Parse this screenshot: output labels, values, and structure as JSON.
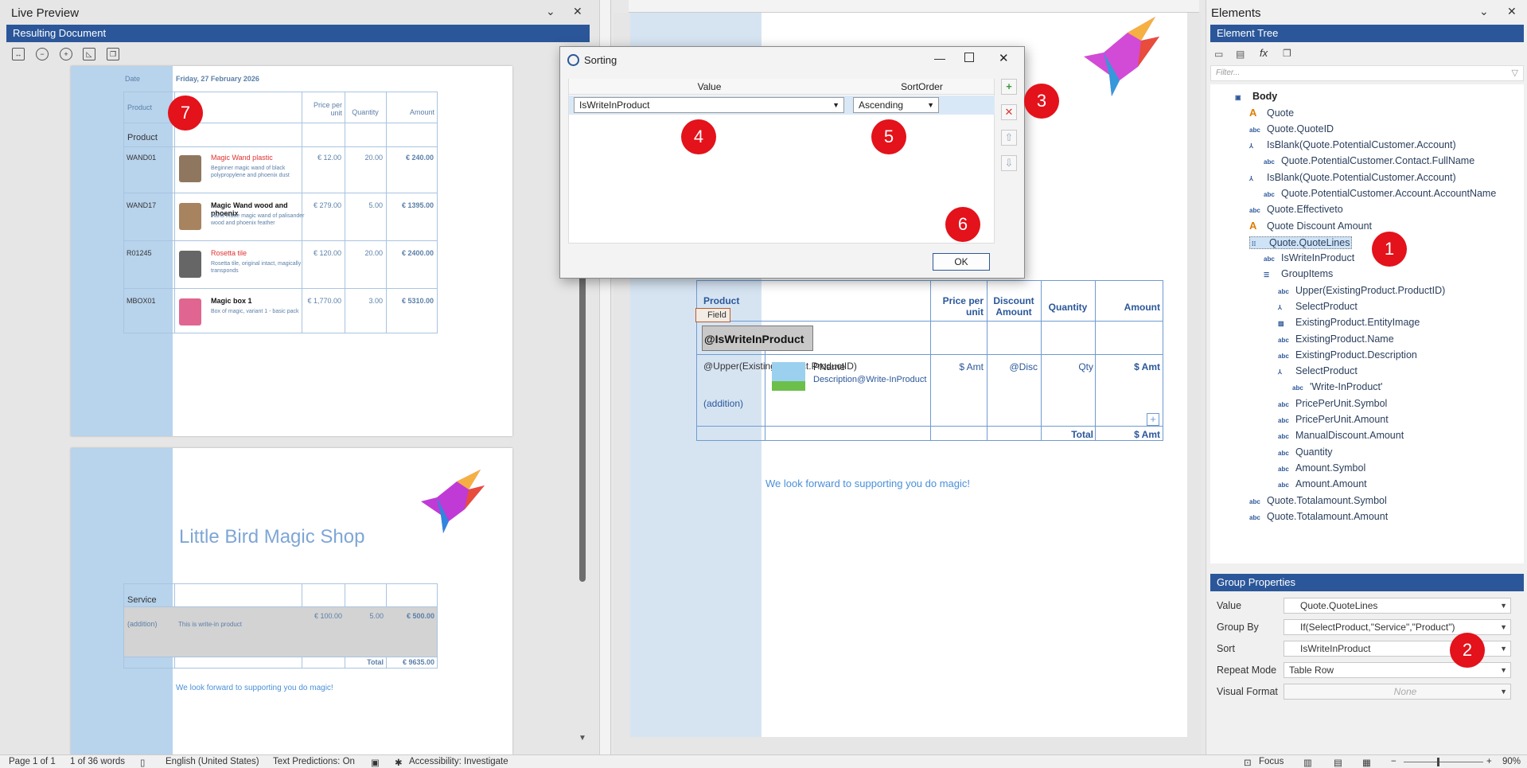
{
  "live_preview": {
    "title": "Live Preview",
    "subtitle": "Resulting Document",
    "page1": {
      "date_label": "Date",
      "date_value": "Friday, 27 February 2026",
      "headers": [
        "Product",
        "Price per unit",
        "Quantity",
        "Amount"
      ],
      "group_label": "Product",
      "rows": [
        {
          "code": "WAND01",
          "name": "Magic Wand plastic",
          "desc": "Beginner magic wand of black polypropylene and phoenix dust",
          "price": "€ 12.00",
          "qty": "20.00",
          "amount": "€ 240.00"
        },
        {
          "code": "WAND17",
          "name": "Magic Wand wood and phoenix",
          "desc": "Hand made magic wand of palisander wood and phoenix feather",
          "price": "€ 279.00",
          "qty": "5.00",
          "amount": "€ 1395.00"
        },
        {
          "code": "R01245",
          "name": "Rosetta tile",
          "desc": "Rosetta tile, original intact, magically transponds",
          "price": "€ 120.00",
          "qty": "20.00",
          "amount": "€ 2400.00"
        },
        {
          "code": "MBOX01",
          "name": "Magic box 1",
          "desc": "Box of magic, variant 1 - basic pack",
          "price": "€ 1,770.00",
          "qty": "3.00",
          "amount": "€ 5310.00"
        }
      ]
    },
    "page2": {
      "shop_name": "Little Bird Magic Shop",
      "group_label": "Service",
      "row": {
        "code": "(addition)",
        "desc": "This is write-in product",
        "price": "€ 100.00",
        "qty": "5.00",
        "amount": "€ 500.00"
      },
      "total_label": "Total",
      "total_value": "€ 9635.00",
      "footer": "We look forward to supporting you do magic!"
    }
  },
  "editor": {
    "headers": [
      "Product",
      "Price per unit",
      "Discount Amount",
      "Quantity",
      "Amount"
    ],
    "field_tag": "Field",
    "group_field": "@IsWriteInProduct",
    "row_code": "@Upper(ExistingProduct.ProductID)",
    "row_code_suffix": "(addition)",
    "pname": "PName",
    "description": "Description@Write-InProduct",
    "price": "$ Amt",
    "disc": "@Disc",
    "qty": "Qty",
    "amount": "$ Amt",
    "total_label": "Total",
    "total_value": "$ Amt",
    "footer": "We look forward to supporting you do magic!"
  },
  "dialog": {
    "title": "Sorting",
    "col_value": "Value",
    "col_sortorder": "SortOrder",
    "value": "IsWriteInProduct",
    "sortorder": "Ascending",
    "ok": "OK"
  },
  "badges": [
    "1",
    "2",
    "3",
    "4",
    "5",
    "6",
    "7"
  ],
  "elements": {
    "title": "Elements",
    "subtitle": "Element Tree",
    "filter_placeholder": "Filter...",
    "tree": [
      {
        "label": "Body",
        "icon": "page-icon"
      },
      {
        "label": "Quote",
        "icon": "text-style-icon"
      },
      {
        "label": "Quote.QuoteID",
        "icon": "field-icon"
      },
      {
        "label": "IsBlank(Quote.PotentialCustomer.Account)",
        "icon": "condition-icon"
      },
      {
        "label": "Quote.PotentialCustomer.Contact.FullName",
        "icon": "field-icon"
      },
      {
        "label": "IsBlank(Quote.PotentialCustomer.Account)",
        "icon": "condition-icon"
      },
      {
        "label": "Quote.PotentialCustomer.Account.AccountName",
        "icon": "field-icon"
      },
      {
        "label": "Quote.Effectiveto",
        "icon": "field-icon"
      },
      {
        "label": "Quote Discount Amount",
        "icon": "text-style-icon"
      },
      {
        "label": "Quote.QuoteLines",
        "icon": "repeat-icon"
      },
      {
        "label": "IsWriteInProduct",
        "icon": "field-icon"
      },
      {
        "label": "GroupItems",
        "icon": "list-icon"
      },
      {
        "label": "Upper(ExistingProduct.ProductID)",
        "icon": "field-icon"
      },
      {
        "label": "SelectProduct",
        "icon": "condition-icon"
      },
      {
        "label": "ExistingProduct.EntityImage",
        "icon": "image-icon"
      },
      {
        "label": "ExistingProduct.Name",
        "icon": "field-icon"
      },
      {
        "label": "ExistingProduct.Description",
        "icon": "field-icon"
      },
      {
        "label": "SelectProduct",
        "icon": "condition-icon"
      },
      {
        "label": "'Write-InProduct'",
        "icon": "field-icon"
      },
      {
        "label": "PricePerUnit.Symbol",
        "icon": "field-icon"
      },
      {
        "label": "PricePerUnit.Amount",
        "icon": "field-icon"
      },
      {
        "label": "ManualDiscount.Amount",
        "icon": "field-icon"
      },
      {
        "label": "Quantity",
        "icon": "field-icon"
      },
      {
        "label": "Amount.Symbol",
        "icon": "field-icon"
      },
      {
        "label": "Amount.Amount",
        "icon": "field-icon"
      },
      {
        "label": "Quote.Totalamount.Symbol",
        "icon": "field-icon"
      },
      {
        "label": "Quote.Totalamount.Amount",
        "icon": "field-icon"
      }
    ]
  },
  "group_properties": {
    "title": "Group Properties",
    "value_label": "Value",
    "value": "Quote.QuoteLines",
    "groupby_label": "Group By",
    "groupby": "If(SelectProduct,\"Service\",\"Product\")",
    "sort_label": "Sort",
    "sort": "IsWriteInProduct",
    "repeat_label": "Repeat Mode",
    "repeat": "Table Row",
    "visual_label": "Visual Format",
    "visual": "None"
  },
  "status": {
    "page": "Page 1 of 1",
    "words": "1 of 36 words",
    "language": "English (United States)",
    "predictions": "Text Predictions: On",
    "accessibility": "Accessibility: Investigate",
    "focus": "Focus",
    "zoom": "90%"
  },
  "colors": {
    "accent": "#2b579a",
    "badge": "#e3121b",
    "side": "#b8d3ec"
  }
}
